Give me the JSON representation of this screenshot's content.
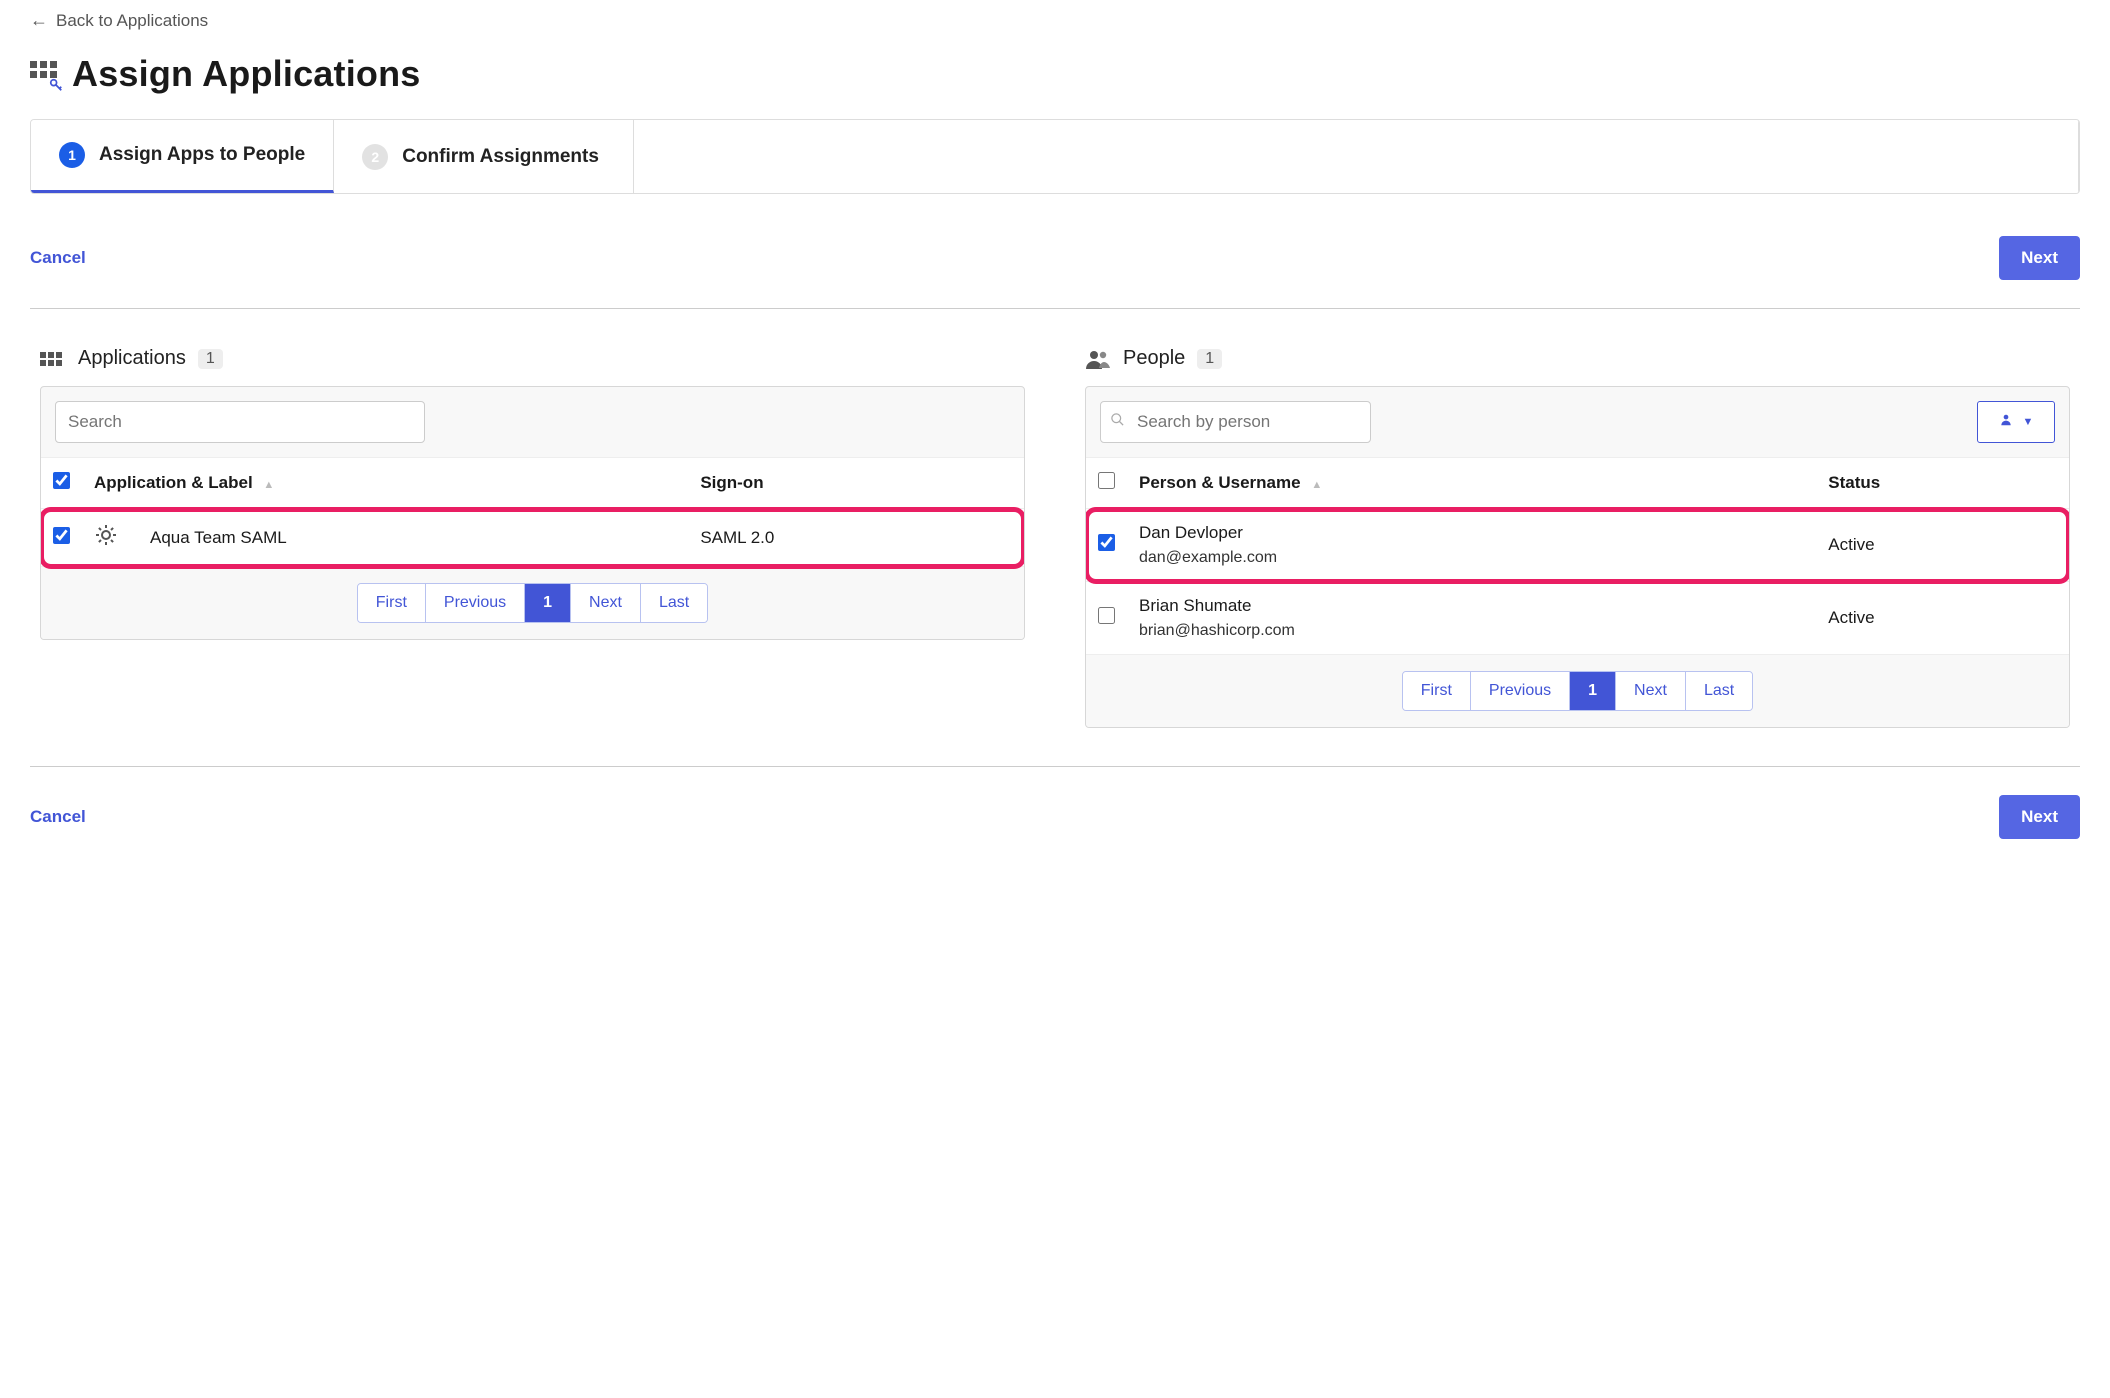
{
  "back_link": "Back to Applications",
  "page_title": "Assign Applications",
  "wizard": {
    "steps": [
      {
        "num": "1",
        "label": "Assign Apps to People",
        "active": true
      },
      {
        "num": "2",
        "label": "Confirm Assignments",
        "active": false
      }
    ]
  },
  "actions": {
    "cancel": "Cancel",
    "next": "Next"
  },
  "applications_panel": {
    "title": "Applications",
    "count": "1",
    "search_placeholder": "Search",
    "columns": {
      "app_label": "Application & Label",
      "sign_on": "Sign-on"
    },
    "rows": [
      {
        "checked": true,
        "name": "Aqua Team SAML",
        "sign_on": "SAML 2.0",
        "highlight": true
      }
    ]
  },
  "people_panel": {
    "title": "People",
    "count": "1",
    "search_placeholder": "Search by person",
    "columns": {
      "person": "Person & Username",
      "status": "Status"
    },
    "rows": [
      {
        "checked": true,
        "name": "Dan Devloper",
        "email": "dan@example.com",
        "status": "Active",
        "highlight": true
      },
      {
        "checked": false,
        "name": "Brian Shumate",
        "email": "brian@hashicorp.com",
        "status": "Active",
        "highlight": false
      }
    ]
  },
  "pager": {
    "first": "First",
    "previous": "Previous",
    "page": "1",
    "next": "Next",
    "last": "Last"
  }
}
